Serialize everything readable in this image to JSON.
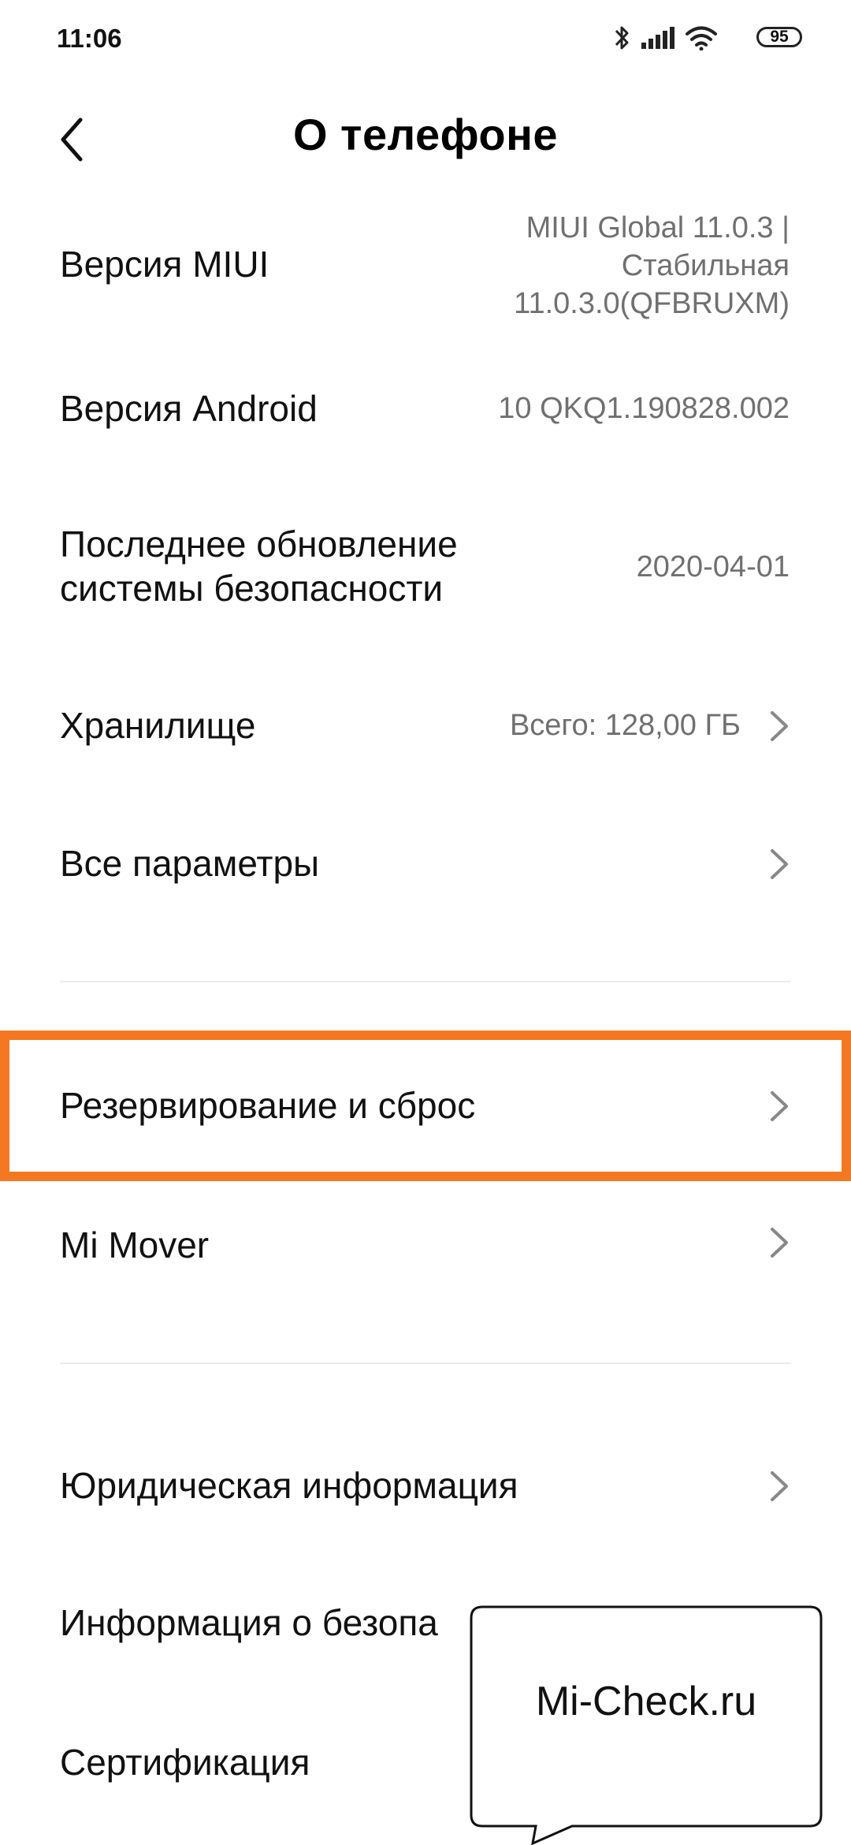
{
  "status_bar": {
    "time": "11:06",
    "battery": "95",
    "icons": [
      "bluetooth-icon",
      "signal-icon",
      "wifi-icon",
      "battery-icon"
    ]
  },
  "header": {
    "title": "О телефоне",
    "back_icon": "chevron-left-icon"
  },
  "rows": [
    {
      "label": "Версия MIUI",
      "value_lines": [
        "MIUI Global 11.0.3 |",
        "Стабильная",
        "11.0.3.0(QFBRUXM)"
      ]
    },
    {
      "label": "Версия Android",
      "value": "10 QKQ1.190828.002"
    },
    {
      "label_lines": [
        "Последнее обновление",
        "системы безопасности"
      ],
      "value": "2020-04-01"
    },
    {
      "label": "Хранилище",
      "value": "Всего: 128,00 ГБ",
      "chevron": true
    },
    {
      "label": "Все параметры",
      "chevron": true
    },
    {
      "label": "Резервирование и сброс",
      "chevron": true,
      "highlighted": true
    },
    {
      "label": "Mi Mover",
      "chevron": true
    },
    {
      "label": "Юридическая информация",
      "chevron": true
    },
    {
      "label": "Информация о безопа"
    },
    {
      "label": "Сертификация"
    }
  ],
  "colors": {
    "highlight": "#f47721",
    "secondary_text": "#707070"
  },
  "watermark": {
    "text": "Mi-Check.ru"
  }
}
